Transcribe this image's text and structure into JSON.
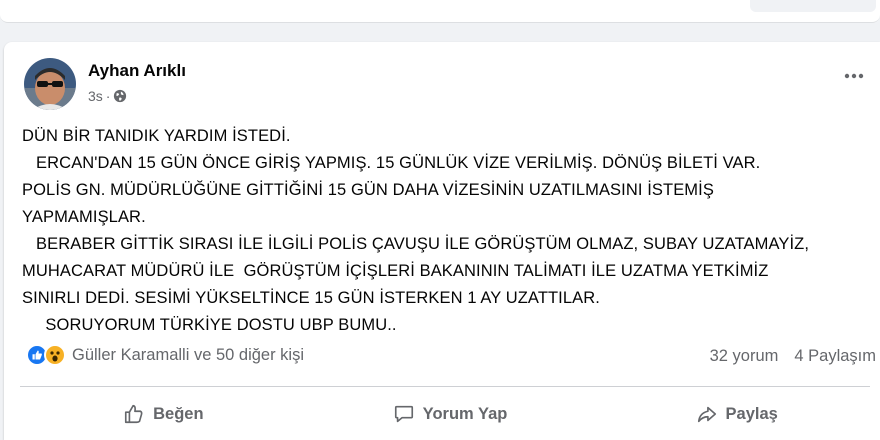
{
  "post": {
    "author": "Ayhan Arıklı",
    "time": "3s",
    "separator": "·",
    "body_lines": [
      "DÜN BİR TANIDIK YARDIM İSTEDİ.",
      "   ERCAN'DAN 15 GÜN ÖNCE GİRİŞ YAPMIŞ. 15 GÜNLÜK VİZE VERİLMİŞ. DÖNÜŞ BİLETİ VAR.",
      "POLİS GN. MÜDÜRLÜĞÜNE GİTTİĞİNİ 15 GÜN DAHA VİZESİNİN UZATILMASINI İSTEMİŞ",
      "YAPMAMIŞLAR.",
      "   BERABER GİTTİK SIRASI İLE İLGİLİ POLİS ÇAVUŞU İLE GÖRÜŞTÜM OLMAZ, SUBAY UZATAMAYİZ,",
      "MUHACARAT MÜDÜRÜ İLE  GÖRÜŞTÜM İÇİŞLERİ BAKANININ TALİMATI İLE UZATMA YETKİMİZ",
      "SINIRLI DEDİ. SESİMİ YÜKSELTİNCE 15 GÜN İSTERKEN 1 AY UZATTILAR.",
      "     SORUYORUM TÜRKİYE DOSTU UBP BUMU.."
    ]
  },
  "reactions": {
    "summary": "Güller Karamalli ve 50 diğer kişi",
    "icons": [
      "like-reaction-icon",
      "wow-reaction-icon"
    ],
    "comments": "32 yorum",
    "shares": "4 Paylaşım"
  },
  "actions": {
    "like": "Beğen",
    "comment": "Yorum Yap",
    "share": "Paylaş"
  },
  "colors": {
    "background": "#f0f2f5",
    "like_blue": "#1877f2",
    "wow_yellow": "#f7b125",
    "secondary_text": "#65676b"
  }
}
